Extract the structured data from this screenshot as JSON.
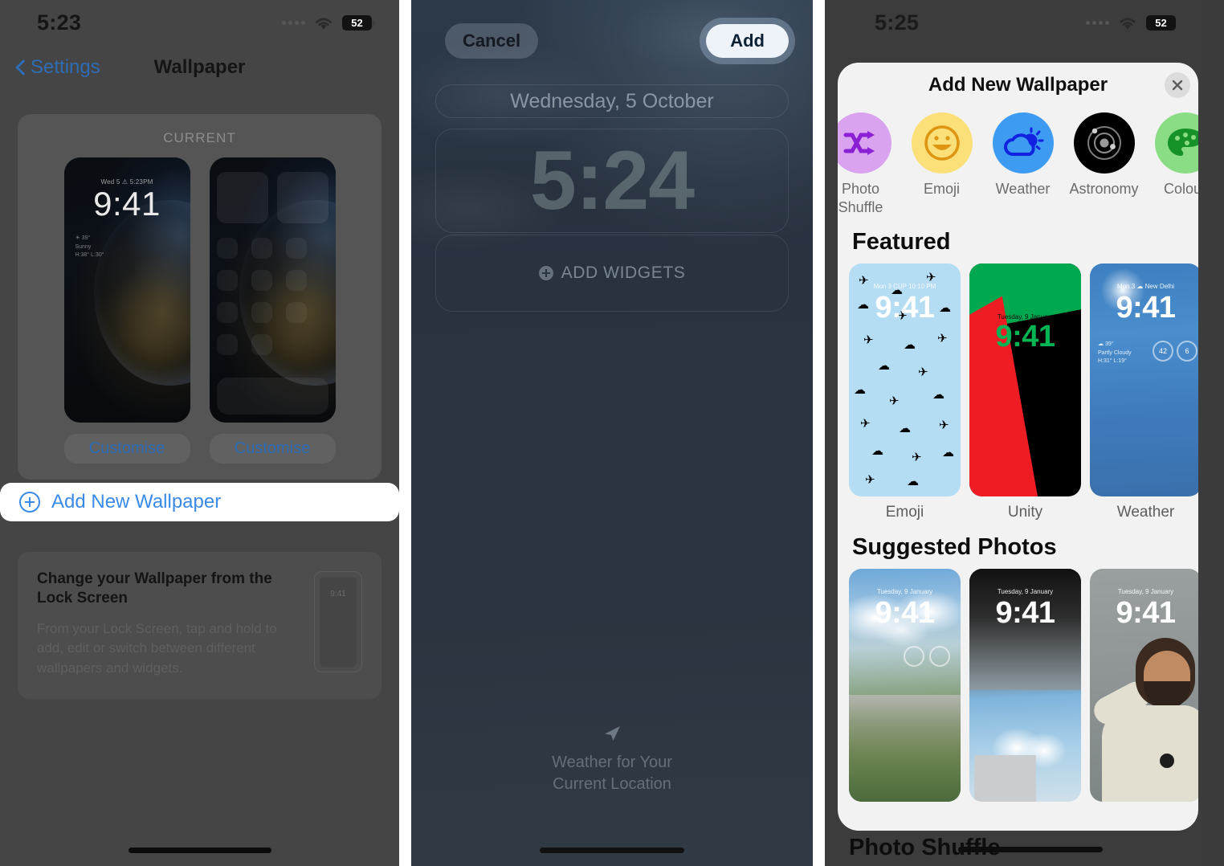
{
  "panel1": {
    "status_bar": {
      "time": "5:23",
      "battery": "52",
      "wifi_icon": "wifi-icon",
      "signal_icon": "signal-dots-icon"
    },
    "nav": {
      "back_label": "Settings",
      "title": "Wallpaper",
      "back_icon": "chevron-left-icon"
    },
    "current_section": {
      "header": "CURRENT",
      "lock_preview": {
        "meta": "Wed 5  ⚠ 5:23PM",
        "clock": "9:41",
        "weather": "☀ 39°\nSunny\nH:38° L:30°"
      },
      "home_preview": {
        "label": "home-screen-preview"
      },
      "customise_lock_label": "Customise",
      "customise_home_label": "Customise"
    },
    "add_new_wallpaper": {
      "label": "Add New Wallpaper",
      "icon": "plus-circle-icon"
    },
    "tip": {
      "title": "Change your Wallpaper from the Lock Screen",
      "description": "From your Lock Screen, tap and hold to add, edit or switch between different wallpapers and widgets.",
      "phone_clock": "9:41"
    }
  },
  "panel2": {
    "cancel_label": "Cancel",
    "add_label": "Add",
    "date": "Wednesday, 5 October",
    "clock": "5:24",
    "add_widgets_label": "ADD WIDGETS",
    "add_widgets_icon": "plus-circle-icon",
    "location_icon": "location-arrow-icon",
    "location_line1": "Weather for Your",
    "location_line2": "Current Location"
  },
  "panel3": {
    "status_bar": {
      "time": "5:25",
      "battery": "52",
      "wifi_icon": "wifi-icon",
      "signal_icon": "signal-dots-icon"
    },
    "sheet_title": "Add New Wallpaper",
    "close_icon": "close-icon",
    "categories": [
      {
        "label": "Photo Shuffle",
        "icon": "shuffle-icon",
        "bg": "#d9a3f0",
        "fg": "#8b1fd4"
      },
      {
        "label": "Emoji",
        "icon": "smiley-icon",
        "bg": "#fbe07a",
        "fg": "#dd9512"
      },
      {
        "label": "Weather",
        "icon": "sun-cloud-icon",
        "bg": "#3d9bf2",
        "fg": "#1122e0"
      },
      {
        "label": "Astronomy",
        "icon": "orbit-icon",
        "bg": "#000000",
        "fg": "#a8a8a8"
      },
      {
        "label": "Colour",
        "icon": "palette-icon",
        "bg": "#8bdd85",
        "fg": "#17922b"
      }
    ],
    "featured": {
      "title": "Featured",
      "items": [
        {
          "name": "Emoji",
          "date": "Mon 3  CUP 10:10 PM",
          "clock": "9:41",
          "style": "wp-emoji"
        },
        {
          "name": "Unity",
          "date": "Tuesday, 9 January",
          "clock": "9:41",
          "style": "wp-unity"
        },
        {
          "name": "Weather",
          "date": "Mon 3  ☁ New Delhi",
          "clock": "9:41",
          "style": "wp-weather",
          "meta": "☁ 39°\nPartly Cloudy\nH:31° L:19°",
          "circle1": "42",
          "circle2": "6"
        }
      ]
    },
    "suggested": {
      "title": "Suggested Photos",
      "items": [
        {
          "date": "Tuesday, 9 January",
          "clock": "9:41",
          "style": "ph-city"
        },
        {
          "date": "Tuesday, 9 January",
          "clock": "9:41",
          "style": "ph-bridge"
        },
        {
          "date": "Tuesday, 9 January",
          "clock": "9:41",
          "style": "ph-person"
        }
      ]
    },
    "bottom_section_title": "Photo Shuffle"
  }
}
